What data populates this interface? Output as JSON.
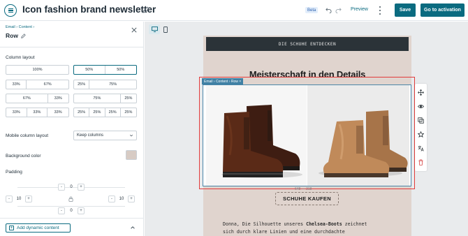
{
  "header": {
    "title": "Icon fashion brand newsletter",
    "beta": "Beta",
    "preview": "Preview",
    "save": "Save",
    "activate": "Go to activation"
  },
  "panel": {
    "breadcrumb": "Email › Content ›",
    "title": "Row",
    "column_layout_label": "Column layout",
    "layouts": [
      [
        "100%"
      ],
      [
        "50%",
        "50%"
      ],
      [
        "33%",
        "67%"
      ],
      [
        "25%",
        "75%"
      ],
      [
        "67%",
        "33%"
      ],
      [
        "75%",
        "25%"
      ],
      [
        "33%",
        "33%",
        "33%"
      ],
      [
        "25%",
        "25%",
        "25%",
        "25%"
      ]
    ],
    "mobile_layout_label": "Mobile column layout",
    "mobile_layout_value": "Keep columns",
    "bg_color_label": "Background color",
    "bg_color": "#d7cbc4",
    "padding_label": "Padding",
    "padding": {
      "top": "0",
      "left": "10",
      "right": "10",
      "bottom": "0"
    },
    "dynamic_content": "Add dynamic content"
  },
  "canvas": {
    "cta_top": "DIE SCHUHE ENTDECKEN",
    "headline": "Meisterschaft in den Details",
    "row_tag": "Email › Content › Row ×",
    "dims": "648 — 318",
    "cta_button": "SCHUHE KAUFEN",
    "body_line1_a": "Donna, Die Silhouette unseres ",
    "body_line1_b": "Chelsea-Boots",
    "body_line1_c": " zeichnet",
    "body_line2": "sich durch klare Linien und eine durchdachte",
    "email_bg": "#e0d4ce"
  }
}
